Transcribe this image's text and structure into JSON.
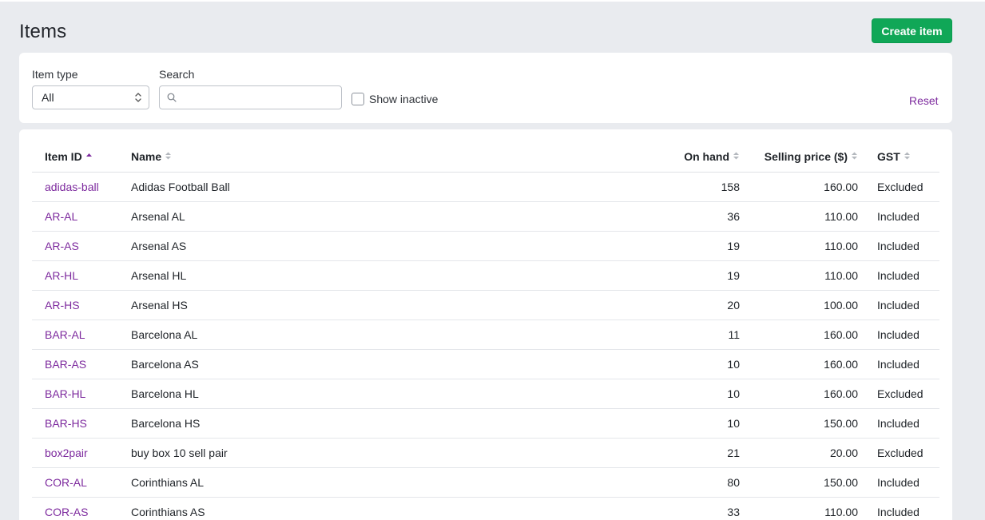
{
  "page": {
    "title": "Items"
  },
  "actions": {
    "create_label": "Create item"
  },
  "filters": {
    "item_type_label": "Item type",
    "item_type_value": "All",
    "search_label": "Search",
    "search_value": "",
    "search_placeholder": "",
    "show_inactive_label": "Show inactive",
    "show_inactive_checked": false,
    "reset_label": "Reset"
  },
  "colors": {
    "accent": "#7d2a9e",
    "primary_button": "#10a757",
    "background": "#e9ebef"
  },
  "table": {
    "columns": [
      {
        "key": "id",
        "label": "Item ID",
        "sort": "asc"
      },
      {
        "key": "name",
        "label": "Name",
        "sort": "none"
      },
      {
        "key": "on_hand",
        "label": "On hand",
        "sort": "none"
      },
      {
        "key": "price",
        "label": "Selling price ($)",
        "sort": "none"
      },
      {
        "key": "gst",
        "label": "GST",
        "sort": "none"
      }
    ],
    "rows": [
      {
        "id": "adidas-ball",
        "name": "Adidas Football Ball",
        "on_hand": "158",
        "price": "160.00",
        "gst": "Excluded"
      },
      {
        "id": "AR-AL",
        "name": "Arsenal AL",
        "on_hand": "36",
        "price": "110.00",
        "gst": "Included"
      },
      {
        "id": "AR-AS",
        "name": "Arsenal AS",
        "on_hand": "19",
        "price": "110.00",
        "gst": "Included"
      },
      {
        "id": "AR-HL",
        "name": "Arsenal HL",
        "on_hand": "19",
        "price": "110.00",
        "gst": "Included"
      },
      {
        "id": "AR-HS",
        "name": "Arsenal HS",
        "on_hand": "20",
        "price": "100.00",
        "gst": "Included"
      },
      {
        "id": "BAR-AL",
        "name": "Barcelona AL",
        "on_hand": "11",
        "price": "160.00",
        "gst": "Included"
      },
      {
        "id": "BAR-AS",
        "name": "Barcelona AS",
        "on_hand": "10",
        "price": "160.00",
        "gst": "Included"
      },
      {
        "id": "BAR-HL",
        "name": "Barcelona HL",
        "on_hand": "10",
        "price": "160.00",
        "gst": "Excluded"
      },
      {
        "id": "BAR-HS",
        "name": "Barcelona HS",
        "on_hand": "10",
        "price": "150.00",
        "gst": "Included"
      },
      {
        "id": "box2pair",
        "name": "buy box 10 sell pair",
        "on_hand": "21",
        "price": "20.00",
        "gst": "Excluded"
      },
      {
        "id": "COR-AL",
        "name": "Corinthians AL",
        "on_hand": "80",
        "price": "150.00",
        "gst": "Included"
      },
      {
        "id": "COR-AS",
        "name": "Corinthians AS",
        "on_hand": "33",
        "price": "110.00",
        "gst": "Included"
      }
    ]
  }
}
